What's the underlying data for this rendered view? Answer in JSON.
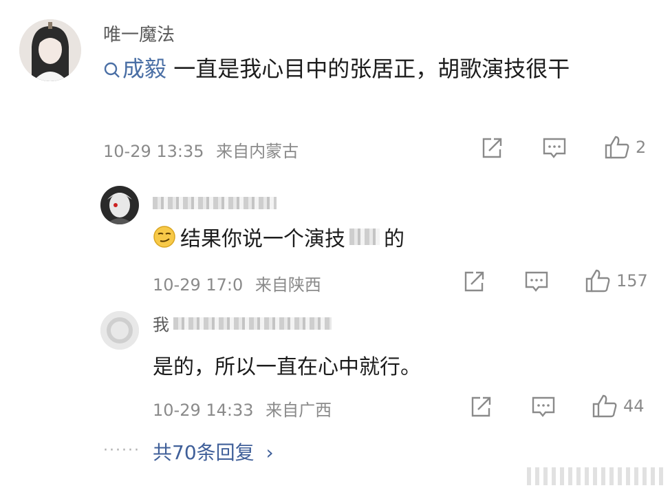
{
  "main_comment": {
    "username": "唯一魔法",
    "topic_link": "成毅",
    "text": " 一直是我心目中的张居正，胡歌演技很干",
    "timestamp": "10-29 13:35",
    "location": "来自内蒙古",
    "like_count": "2"
  },
  "replies": [
    {
      "username": "",
      "text": "结果你说一个演技",
      "text_tail": "的",
      "timestamp": "10-29 17:0",
      "location": "来自陕西",
      "like_count": "157"
    },
    {
      "username": "我",
      "text": "是的，所以一直在心中就行。",
      "timestamp": "10-29 14:33",
      "location": "来自广西",
      "like_count": "44"
    }
  ],
  "more_replies_label": "共70条回复",
  "more_replies_chevron": "›",
  "icons": {
    "share": "share-icon",
    "comment": "comment-icon",
    "like": "thumbs-up-icon",
    "search": "search-icon",
    "emoji": "smirk-emoji-icon"
  }
}
